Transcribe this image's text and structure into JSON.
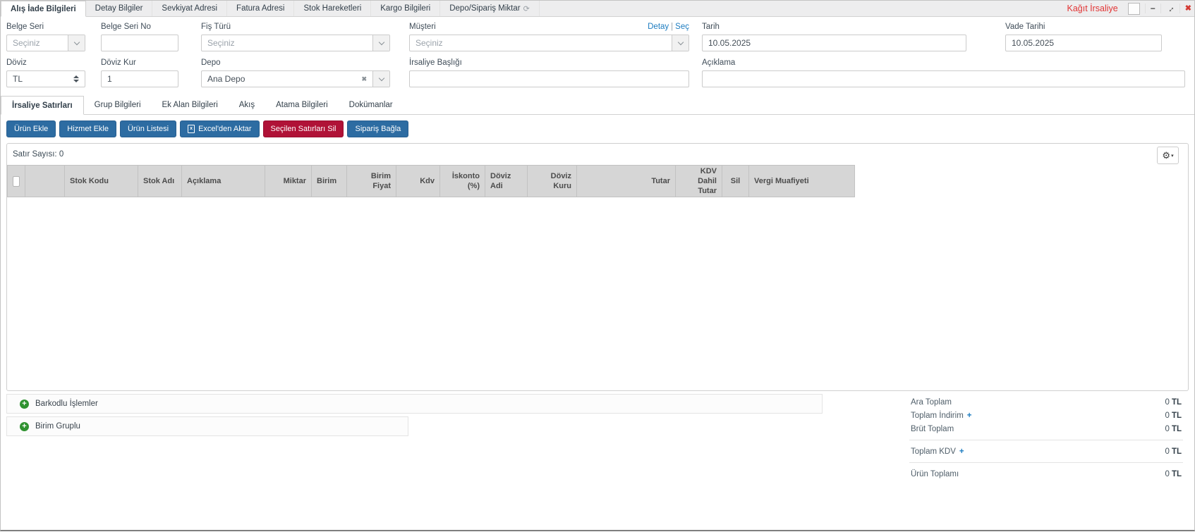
{
  "titlebar": {
    "tabs": [
      {
        "label": "Alış İade Bilgileri"
      },
      {
        "label": "Detay Bilgiler"
      },
      {
        "label": "Sevkiyat Adresi"
      },
      {
        "label": "Fatura Adresi"
      },
      {
        "label": "Stok Hareketleri"
      },
      {
        "label": "Kargo Bilgileri"
      },
      {
        "label": "Depo/Sipariş Miktar"
      }
    ],
    "paper_link": "Kağıt İrsaliye",
    "icons": {
      "refresh": "⟳",
      "minimize": "−",
      "maximize": "↔",
      "close": "✖"
    }
  },
  "form": {
    "belge_seri": {
      "label": "Belge Seri",
      "placeholder": "Seçiniz"
    },
    "belge_seri_no": {
      "label": "Belge Seri No",
      "value": ""
    },
    "fis_turu": {
      "label": "Fiş Türü",
      "placeholder": "Seçiniz"
    },
    "musteri": {
      "label": "Müşteri",
      "placeholder": "Seçiniz",
      "detay_link": "Detay",
      "sec_link": "Seç",
      "link_sep": "|"
    },
    "tarih": {
      "label": "Tarih",
      "value": "10.05.2025"
    },
    "vade_tarihi": {
      "label": "Vade Tarihi",
      "value": "10.05.2025"
    },
    "doviz": {
      "label": "Döviz",
      "value": "TL"
    },
    "doviz_kur": {
      "label": "Döviz Kur",
      "value": "1"
    },
    "depo": {
      "label": "Depo",
      "value": "Ana Depo",
      "clear_icon": "✖"
    },
    "irsaliye_basligi": {
      "label": "İrsaliye Başlığı",
      "value": ""
    },
    "aciklama": {
      "label": "Açıklama",
      "value": ""
    }
  },
  "detail_tabs": [
    {
      "label": "İrsaliye Satırları"
    },
    {
      "label": "Grup Bilgileri"
    },
    {
      "label": "Ek Alan Bilgileri"
    },
    {
      "label": "Akış"
    },
    {
      "label": "Atama Bilgileri"
    },
    {
      "label": "Dokümanlar"
    }
  ],
  "toolbar": {
    "buttons": [
      {
        "label": "Ürün Ekle"
      },
      {
        "label": "Hizmet Ekle"
      },
      {
        "label": "Ürün Listesi"
      },
      {
        "label": "Excel'den Aktar",
        "icon": "x"
      },
      {
        "label": "Seçilen Satırları Sil"
      },
      {
        "label": "Sipariş Bağla"
      }
    ]
  },
  "grid": {
    "row_count": "Satır Sayısı: 0",
    "gear_icon": "⚙",
    "gear_caret": "▾",
    "columns": [
      {
        "label": ""
      },
      {
        "label": ""
      },
      {
        "label": "Stok Kodu"
      },
      {
        "label": "Stok Adı"
      },
      {
        "label": "Açıklama"
      },
      {
        "label": "Miktar"
      },
      {
        "label": "Birim"
      },
      {
        "label": "Birim Fiyat"
      },
      {
        "label": "Kdv"
      },
      {
        "label": "İskonto (%)"
      },
      {
        "label": "Döviz Adi"
      },
      {
        "label": "Döviz Kuru"
      },
      {
        "label": "Tutar"
      },
      {
        "label": "KDV Dahil Tutar"
      },
      {
        "label": "Sil"
      },
      {
        "label": "Vergi Muafiyeti"
      }
    ]
  },
  "accordions": [
    {
      "label": "Barkodlu İşlemler",
      "icon": "+"
    },
    {
      "label": "Birim Gruplu",
      "icon": "+"
    }
  ],
  "totals": {
    "rows": [
      {
        "label": "Ara Toplam",
        "value": "0",
        "currency": "TL"
      },
      {
        "label": "Toplam İndirim",
        "value": "0",
        "currency": "TL",
        "plus_icon": "+"
      },
      {
        "label": "Brüt Toplam",
        "value": "0",
        "currency": "TL"
      },
      {
        "label": "Toplam KDV",
        "value": "0",
        "currency": "TL",
        "plus_icon": "+"
      },
      {
        "label": "Ürün Toplamı",
        "value": "0",
        "currency": "TL"
      }
    ]
  },
  "colors": {
    "accent_blue": "#2d6ca2",
    "danger_red": "#b01237",
    "link_blue": "#1c7cc0",
    "paper_link_red": "#e23434",
    "header_grey": "#d6d6d6",
    "plus_green": "#2f9230"
  }
}
